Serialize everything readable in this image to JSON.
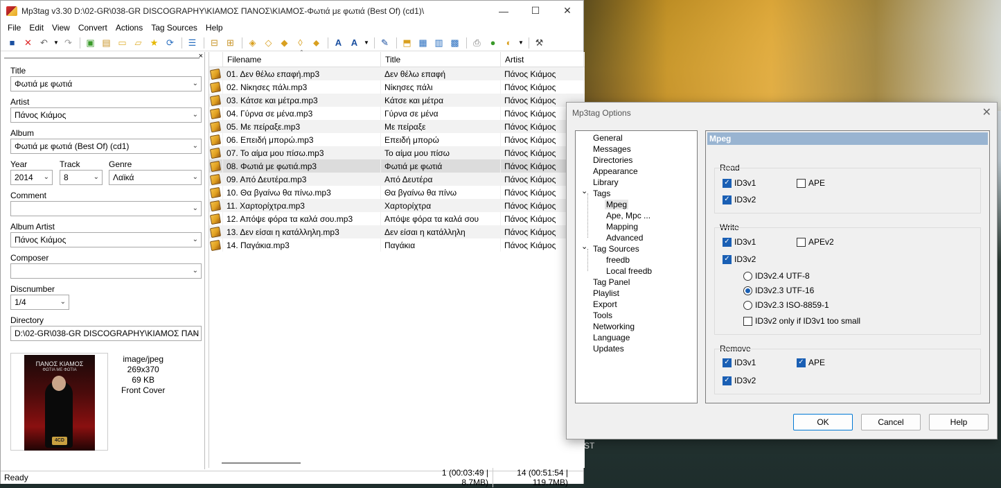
{
  "window": {
    "title": "Mp3tag v3.30   D:\\02-GR\\038-GR DISCOGRAPHY\\ΚΙΑΜΟΣ ΠΑΝΟΣ\\ΚΙΑΜΟΣ-Φωτιά με φωτιά (Best Of) (cd1)\\",
    "minimize": "—",
    "maximize": "☐",
    "close": "✕"
  },
  "menu": [
    "File",
    "Edit",
    "View",
    "Convert",
    "Actions",
    "Tag Sources",
    "Help"
  ],
  "toolbar_icons": [
    "save-icon",
    "remove-tag-icon",
    "undo-icon",
    "undo-dropdown-icon",
    "redo-icon",
    "add-directory-icon",
    "add-files-icon",
    "open-folder-icon",
    "favorites-folder-icon",
    "star-icon",
    "refresh-icon",
    "playlist-icon",
    "export-icon",
    "tag-filename-icon",
    "filename-tag-icon",
    "text-filename-icon",
    "filename-filename-icon",
    "tag-tag-icon",
    "actions-icon",
    "actions-dropdown-icon",
    "extended-tags-icon",
    "case-icon",
    "case-dropdown-icon",
    "options-edit-icon",
    "open-playlist-icon",
    "web-sources-icon",
    "freedb-icon",
    "help-icon",
    "tools-icon"
  ],
  "tag_panel": {
    "close": "×",
    "title_label": "Title",
    "title_value": "Φωτιά με φωτιά",
    "artist_label": "Artist",
    "artist_value": "Πάνος Κιάμος",
    "album_label": "Album",
    "album_value": "Φωτιά με φωτιά (Best Of) (cd1)",
    "year_label": "Year",
    "year_value": "2014",
    "track_label": "Track",
    "track_value": "8",
    "genre_label": "Genre",
    "genre_value": "Λαϊκά",
    "comment_label": "Comment",
    "comment_value": "",
    "album_artist_label": "Album Artist",
    "album_artist_value": "Πάνος Κιάμος",
    "composer_label": "Composer",
    "composer_value": "",
    "discnumber_label": "Discnumber",
    "discnumber_value": "1/4",
    "directory_label": "Directory",
    "directory_value": "D:\\02-GR\\038-GR DISCOGRAPHY\\ΚΙΑΜΟΣ ΠΑΝ",
    "cover": {
      "mime": "image/jpeg",
      "size": "269x370",
      "bytes": "69 KB",
      "type": "Front Cover",
      "art_title": "ΠΑΝΟΣ ΚΙΑΜΟΣ",
      "art_subtitle": "ΦΩΤΙΑ ΜΕ ΦΩΤΙΑ",
      "art_badge": "4CD"
    }
  },
  "file_list": {
    "columns": [
      "Filename",
      "Title",
      "Artist"
    ],
    "rows": [
      {
        "filename": "01. Δεν θέλω επαφή.mp3",
        "title": "Δεν θέλω επαφή",
        "artist": "Πάνος Κιάμος"
      },
      {
        "filename": "02. Νίκησες πάλι.mp3",
        "title": "Νίκησες πάλι",
        "artist": "Πάνος Κιάμος"
      },
      {
        "filename": "03. Κάτσε και μέτρα.mp3",
        "title": "Κάτσε και μέτρα",
        "artist": "Πάνος Κιάμος"
      },
      {
        "filename": "04. Γύρνα σε μένα.mp3",
        "title": "Γύρνα σε μένα",
        "artist": "Πάνος Κιάμος"
      },
      {
        "filename": "05. Με πείραξε.mp3",
        "title": "Με πείραξε",
        "artist": "Πάνος Κιάμος"
      },
      {
        "filename": "06. Επειδή μπορώ.mp3",
        "title": "Επειδή μπορώ",
        "artist": "Πάνος Κιάμος"
      },
      {
        "filename": "07. Το αίμα μου πίσω.mp3",
        "title": "Το αίμα μου πίσω",
        "artist": "Πάνος Κιάμος"
      },
      {
        "filename": "08. Φωτιά με φωτιά.mp3",
        "title": "Φωτιά με φωτιά",
        "artist": "Πάνος Κιάμος"
      },
      {
        "filename": "09. Από Δευτέρα.mp3",
        "title": "Από Δευτέρα",
        "artist": "Πάνος Κιάμος"
      },
      {
        "filename": "10. Θα βγαίνω θα πίνω.mp3",
        "title": "Θα βγαίνω θα πίνω",
        "artist": "Πάνος Κιάμος"
      },
      {
        "filename": "11. Χαρτορίχτρα.mp3",
        "title": "Χαρτορίχτρα",
        "artist": "Πάνος Κιάμος"
      },
      {
        "filename": "12. Απόψε φόρα τα καλά σου.mp3",
        "title": "Απόψε φόρα τα καλά σου",
        "artist": "Πάνος Κιάμος"
      },
      {
        "filename": "13. Δεν είσαι η κατάλληλη.mp3",
        "title": "Δεν είσαι η κατάλληλη",
        "artist": "Πάνος Κιάμος"
      },
      {
        "filename": "14. Παγάκια.mp3",
        "title": "Παγάκια",
        "artist": "Πάνος Κιάμος"
      }
    ],
    "selected_index": 7
  },
  "status": {
    "left": "Ready",
    "selection": "1 (00:03:49 | 8.7MB)",
    "total": "14 (00:51:54 | 119.7MB)"
  },
  "dialog": {
    "title": "Mp3tag Options",
    "close": "✕",
    "tree": [
      {
        "label": "General"
      },
      {
        "label": "Messages"
      },
      {
        "label": "Directories"
      },
      {
        "label": "Appearance"
      },
      {
        "label": "Library"
      },
      {
        "label": "Tags",
        "expander": "⌄"
      },
      {
        "label": "Mpeg"
      },
      {
        "label": "Ape, Mpc ..."
      },
      {
        "label": "Mapping"
      },
      {
        "label": "Advanced"
      },
      {
        "label": "Tag Sources",
        "expander": "⌄"
      },
      {
        "label": "freedb"
      },
      {
        "label": "Local freedb"
      },
      {
        "label": "Tag Panel"
      },
      {
        "label": "Playlist"
      },
      {
        "label": "Export"
      },
      {
        "label": "Tools"
      },
      {
        "label": "Networking"
      },
      {
        "label": "Language"
      },
      {
        "label": "Updates"
      }
    ],
    "selected_node": "Mpeg",
    "panel_title": "Mpeg",
    "read": {
      "label": "Read",
      "id3v1": "ID3v1",
      "ape": "APE",
      "id3v2": "ID3v2",
      "id3v1_checked": true,
      "ape_checked": false,
      "id3v2_checked": true
    },
    "write": {
      "label": "Write",
      "id3v1": "ID3v1",
      "apev2": "APEv2",
      "id3v2": "ID3v2",
      "r24": "ID3v2.4 UTF-8",
      "r23u": "ID3v2.3 UTF-16",
      "r23i": "ID3v2.3 ISO-8859-1",
      "only_if": "ID3v2 only if ID3v1 too small",
      "id3v1_checked": true,
      "apev2_checked": false,
      "id3v2_checked": true,
      "selected_radio": "ID3v2.3 UTF-16",
      "only_if_checked": false
    },
    "remove": {
      "label": "Remove",
      "id3v1": "ID3v1",
      "ape": "APE",
      "id3v2": "ID3v2",
      "id3v1_checked": true,
      "ape_checked": true,
      "id3v2_checked": true
    },
    "buttons": {
      "ok": "OK",
      "cancel": "Cancel",
      "help": "Help"
    }
  },
  "desktop_fragment": "ST"
}
